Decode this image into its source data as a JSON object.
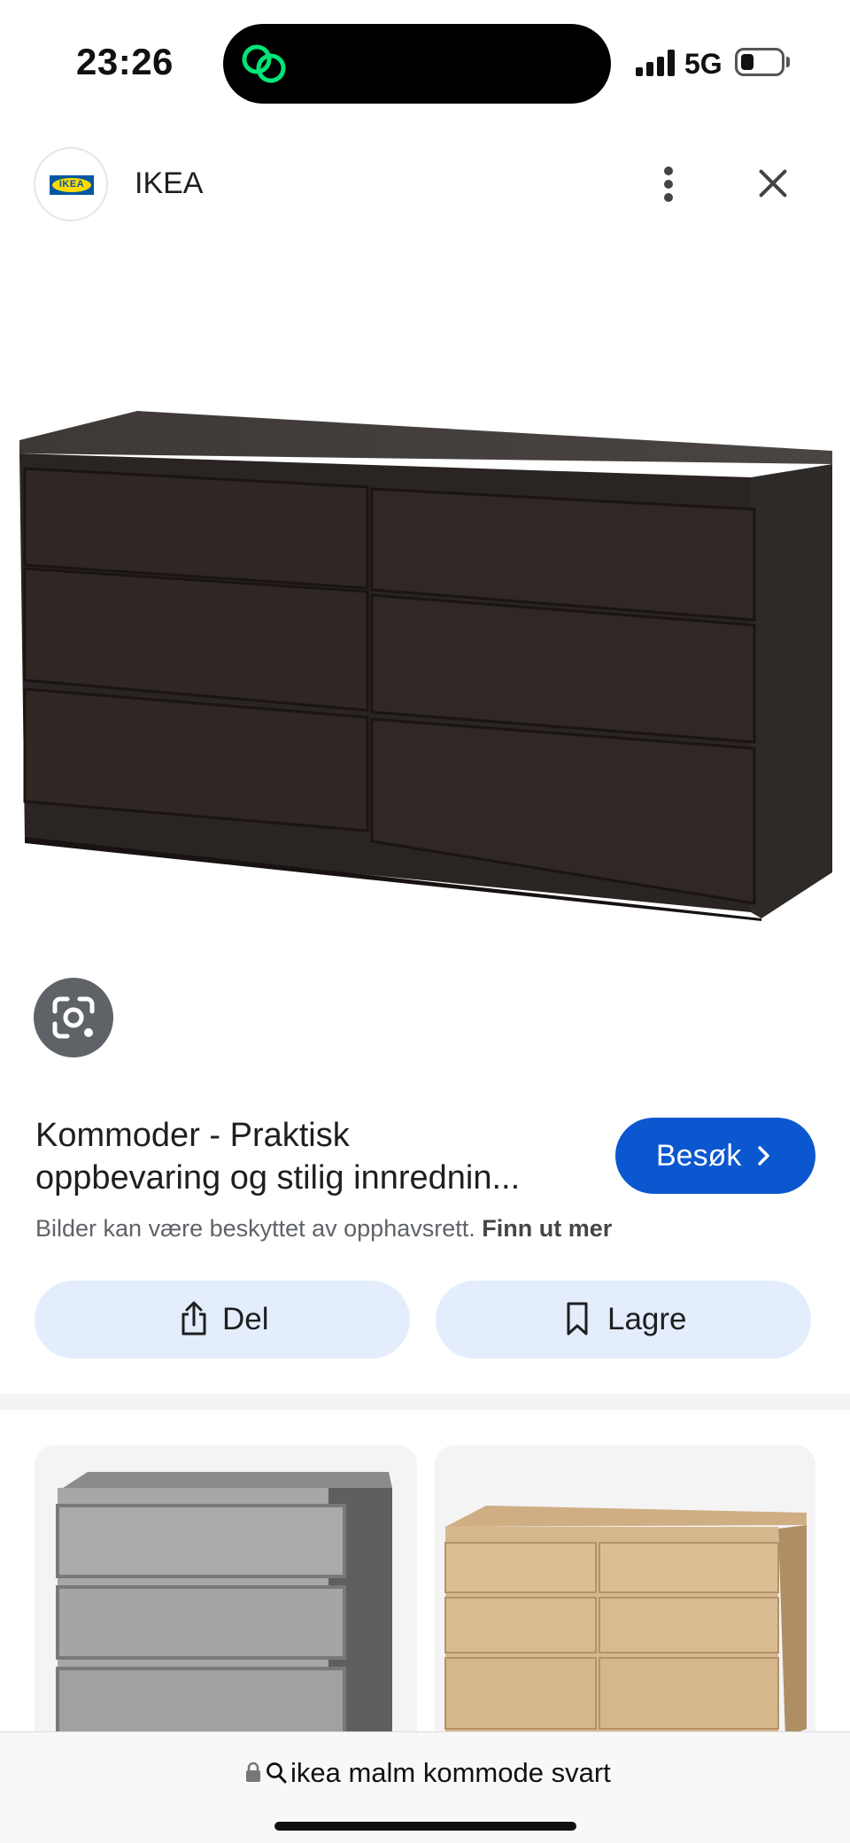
{
  "status_bar": {
    "time": "23:26",
    "network": "5G",
    "island_icon": "green-link-icon",
    "island_accent": "#00e676"
  },
  "header": {
    "site_name": "IKEA",
    "logo_text": "IKEA",
    "logo_colors": {
      "blue": "#0058a3",
      "yellow": "#ffdb00"
    },
    "more_icon": "more-vertical-icon",
    "close_icon": "close-icon"
  },
  "image": {
    "lens_icon": "lens-icon"
  },
  "result": {
    "title_line1": "Kommoder - Praktisk",
    "title_line2": "oppbevaring og stilig innrednin...",
    "visit_label": "Besøk",
    "visit_color": "#0b57d0",
    "copyright_text": "Bilder kan være beskyttet av opphavsrett.",
    "learn_more": "Finn ut mer"
  },
  "actions": {
    "share_label": "Del",
    "save_label": "Lagre",
    "button_color": "#e3edfc"
  },
  "related": [
    {
      "icon": "grey-dresser-thumbnail"
    },
    {
      "icon": "oak-dresser-thumbnail"
    }
  ],
  "url_bar": {
    "query": "ikea malm kommode svart"
  }
}
